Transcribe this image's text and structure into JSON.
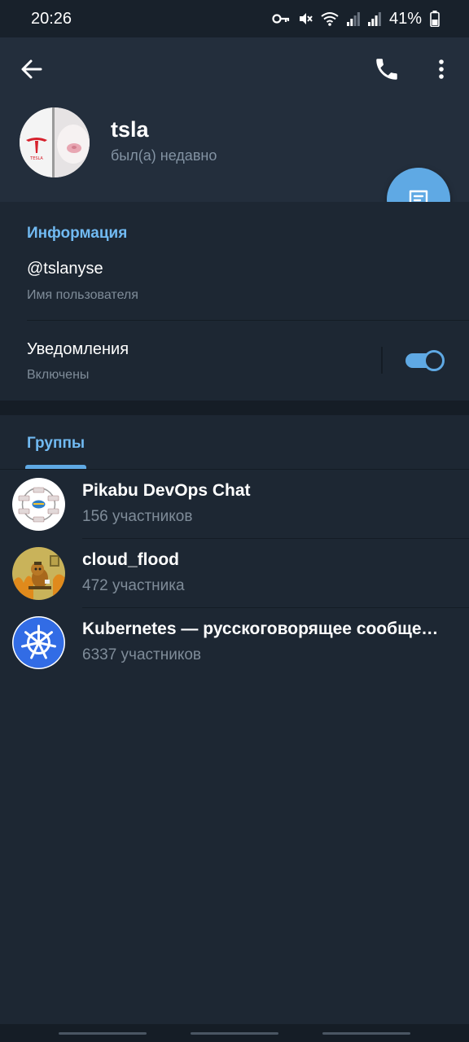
{
  "status_bar": {
    "time": "20:26",
    "battery": "41%",
    "icons": [
      "key-icon",
      "mute-icon",
      "wifi-icon",
      "signal-icon",
      "signal-icon",
      "battery-icon"
    ]
  },
  "header": {
    "icons": [
      "back-arrow-icon",
      "phone-icon",
      "more-vertical-icon"
    ],
    "name": "tsla",
    "status": "был(а) недавно",
    "avatar_text": "TESLA",
    "fab_icon": "message-icon"
  },
  "info": {
    "title": "Информация",
    "username": "@tslanyse",
    "username_label": "Имя пользователя",
    "notifications_title": "Уведомления",
    "notifications_status": "Включены",
    "notifications_enabled": true
  },
  "tabs": {
    "groups": "Группы"
  },
  "groups": [
    {
      "name": "Pikabu DevOps Chat",
      "members": "156 участников"
    },
    {
      "name": "cloud_flood",
      "members": "472 участника"
    },
    {
      "name": "Kubernetes — русскоговорящее сообщество",
      "members": "6337 участников"
    }
  ],
  "colors": {
    "background": "#1d2733",
    "header": "#232e3c",
    "accent": "#5fa9e4",
    "accent_text": "#71baf2",
    "secondary_text": "#7f8c99"
  }
}
